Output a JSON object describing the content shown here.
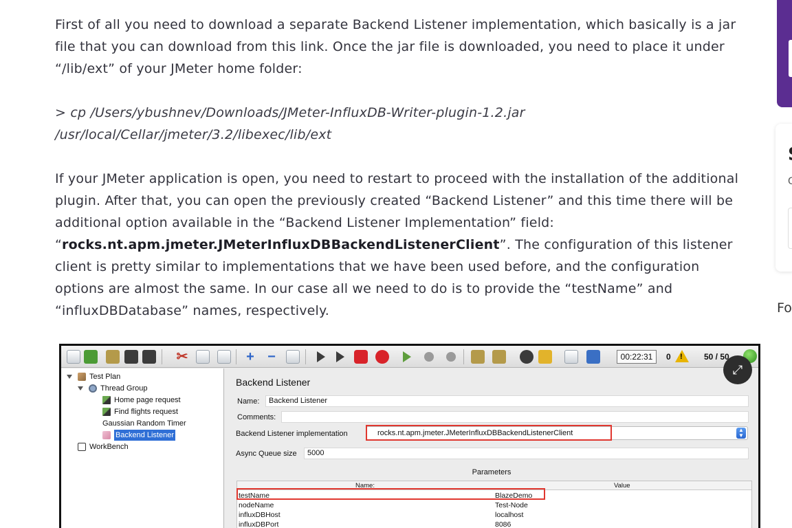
{
  "article": {
    "p1": "First of all you need to download a separate Backend Listener implementation, which basically is a jar file that you can download from this link. Once the jar file is downloaded, you need to place it under “/lib/ext” of your JMeter home folder:",
    "cmd": "> cp /Users/ybushnev/Downloads/JMeter-InfluxDB-Writer-plugin-1.2.jar /usr/local/Cellar/jmeter/3.2/libexec/lib/ext",
    "p3_before": "If your JMeter application is open, you need to restart to proceed with the installation of the additional plugin. After that, you can open the previously created “Backend Listener” and this time there will be additional option available in the “Backend Listener Implementation” field: “",
    "p3_bold": "rocks.nt.apm.jmeter.JMeterInfluxDBBackendListenerClient",
    "p3_after": "”. The configuration of this listener client is pretty similar to implementations that we have been used before, and the configuration options are almost the same. In our case all we need to do is to provide the “testName” and “influxDBDatabase” names, respectively."
  },
  "sidebar": {
    "card_letter": "S",
    "card_sub": "G",
    "fo_text": "Fo",
    "purple_color": "#5b2d91"
  },
  "jmeter": {
    "toolbar": {
      "timer": "00:22:31",
      "errors": "0",
      "threads": "50 / 50",
      "icons": [
        "new-icon",
        "templates-icon",
        "open-icon",
        "save-icon",
        "save-as-icon",
        "cut-icon",
        "copy-icon",
        "paste-icon",
        "expand-icon",
        "collapse-icon",
        "toggle-icon",
        "start-icon",
        "start-no-pause-icon",
        "stop-icon",
        "shutdown-icon",
        "remote-start-icon",
        "remote-stop-icon",
        "remote-shutdown-icon",
        "clear-icon",
        "clear-all-icon",
        "search-icon",
        "reset-search-icon",
        "function-helper-icon",
        "help-icon"
      ]
    },
    "tree": {
      "test_plan": "Test Plan",
      "thread_group": "Thread Group",
      "home_page_request": "Home page request",
      "find_flights_request": "Find flights request",
      "gaussian_random_timer": "Gaussian Random Timer",
      "backend_listener": "Backend Listener",
      "workbench": "WorkBench"
    },
    "panel": {
      "title": "Backend Listener",
      "name_label": "Name:",
      "name_value": "Backend Listener",
      "comments_label": "Comments:",
      "impl_label": "Backend Listener implementation",
      "impl_value": "rocks.nt.apm.jmeter.JMeterInfluxDBBackendListenerClient",
      "async_label": "Async Queue size",
      "async_value": "5000",
      "params_title": "Parameters",
      "col_name": "Name:",
      "col_value": "Value",
      "params": [
        {
          "name": "testName",
          "value": "BlazeDemo"
        },
        {
          "name": "nodeName",
          "value": "Test-Node"
        },
        {
          "name": "influxDBHost",
          "value": "localhost"
        },
        {
          "name": "influxDBPort",
          "value": "8086"
        }
      ]
    },
    "highlight_color": "#e0372f"
  }
}
